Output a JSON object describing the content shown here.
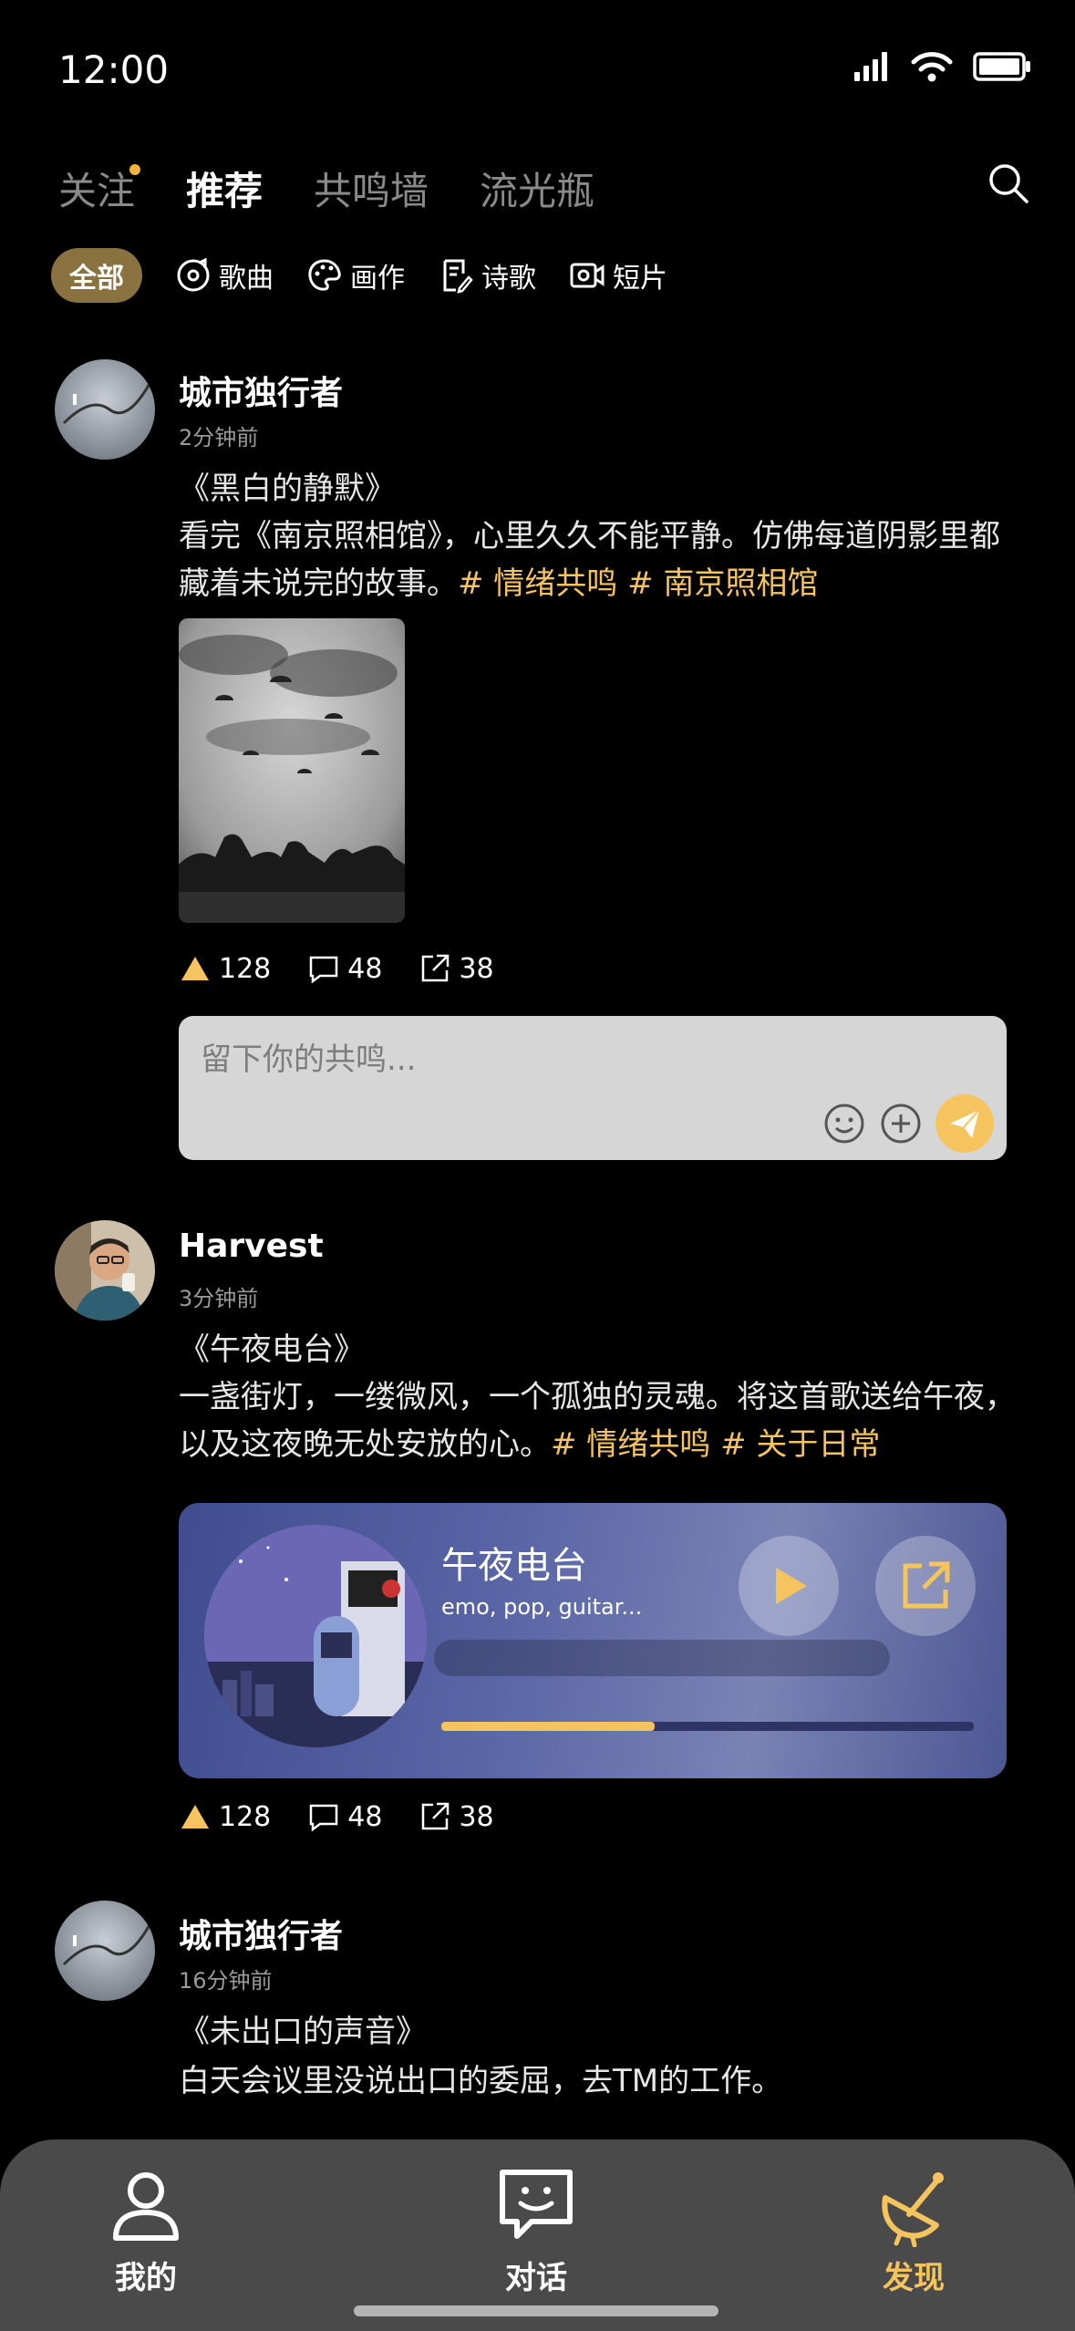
{
  "status_bar": {
    "time": "12:00"
  },
  "top_nav": {
    "tabs": [
      {
        "label": "关注",
        "has_dot": true
      },
      {
        "label": "推荐",
        "active": true
      },
      {
        "label": "共鸣墙"
      },
      {
        "label": "流光瓶"
      }
    ]
  },
  "filters": {
    "all": "全部",
    "items": [
      {
        "label": "歌曲",
        "icon": "music-disc-icon"
      },
      {
        "label": "画作",
        "icon": "palette-icon"
      },
      {
        "label": "诗歌",
        "icon": "poem-icon"
      },
      {
        "label": "短片",
        "icon": "video-icon"
      }
    ]
  },
  "posts": [
    {
      "user": "城市独行者",
      "time": "2分钟前",
      "title": "《黑白的静默》",
      "body": "看完《南京照相馆》，心里久久不能平静。仿佛每道阴影里都藏着未说完的故事。",
      "tags": [
        "# 情绪共鸣",
        "# 南京照相馆"
      ],
      "likes": "128",
      "comments": "48",
      "shares": "38",
      "comment_placeholder": "留下你的共鸣..."
    },
    {
      "user": "Harvest",
      "time": "3分钟前",
      "title": "《午夜电台》",
      "body": "一盏街灯，一缕微风，一个孤独的灵魂。将这首歌送给午夜，以及这夜晚无处安放的心。",
      "tags": [
        "# 情绪共鸣",
        "# 关于日常"
      ],
      "music": {
        "title": "午夜电台",
        "genres": "emo, pop, guitar...",
        "progress": 0.4
      },
      "likes": "128",
      "comments": "48",
      "shares": "38"
    },
    {
      "user": "城市独行者",
      "time": "16分钟前",
      "title": "《未出口的声音》",
      "body": "白天会议里没说出口的委屈，去TM的工作。"
    }
  ],
  "tabbar": {
    "items": [
      {
        "label": "我的",
        "icon": "person-icon"
      },
      {
        "label": "对话",
        "icon": "chat-smile-icon"
      },
      {
        "label": "发现",
        "icon": "satellite-dish-icon",
        "active": true
      }
    ]
  },
  "colors": {
    "accent": "#f5c45e",
    "chip": "#8a7240",
    "tabbar": "#4a4a4a"
  }
}
